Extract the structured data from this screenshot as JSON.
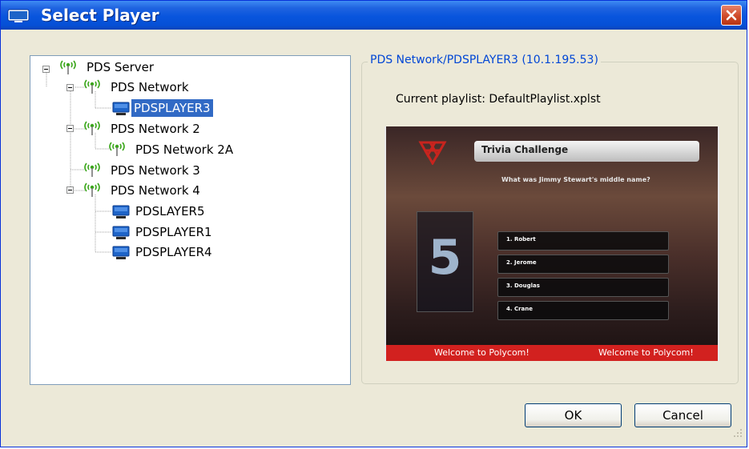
{
  "window": {
    "title": "Select Player"
  },
  "tree": {
    "root": "PDS Server",
    "nodes": {
      "network": "PDS Network",
      "player3": "PDSPLAYER3",
      "network2": "PDS Network 2",
      "network2a": "PDS Network 2A",
      "network3": "PDS Network 3",
      "network4": "PDS Network 4",
      "player5": "PDSLAYER5",
      "player1": "PDSPLAYER1",
      "player4": "PDSPLAYER4"
    },
    "selected": "PDSPLAYER3"
  },
  "details": {
    "group_title": "PDS Network/PDSPLAYER3 (10.1.195.53)",
    "current_playlist": "Current playlist: DefaultPlaylist.xplst"
  },
  "preview": {
    "header": "Trivia Challenge",
    "question": "What was Jimmy Stewart's middle name?",
    "timer": "5",
    "answers": [
      "1.  Robert",
      "2.  Jerome",
      "3.  Douglas",
      "4.  Crane"
    ],
    "footer_text_1": "Welcome to Polycom!",
    "footer_text_2": "Welcome to Polycom!"
  },
  "buttons": {
    "ok": "OK",
    "cancel": "Cancel"
  },
  "colors": {
    "titlebar": "#0855dd",
    "selection": "#316ac5",
    "group_title": "#0046d5",
    "network_icon": "#3aa61a",
    "player_icon": "#1e64c8"
  },
  "icons": {
    "network": "antenna-icon",
    "player": "monitor-icon",
    "expand": "minus-box-icon"
  }
}
